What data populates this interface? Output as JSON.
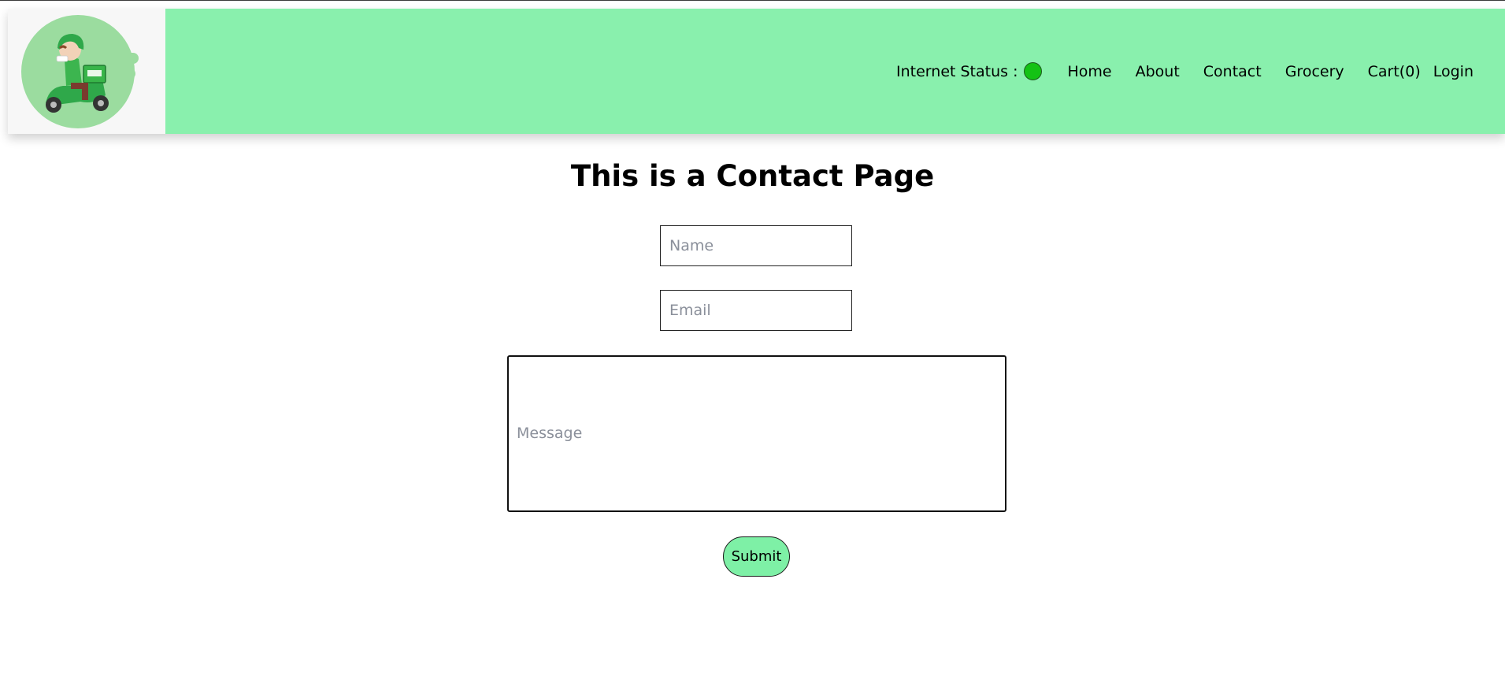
{
  "header": {
    "logo_alt": "delivery-scooter-logo",
    "internet_status_label": "Internet Status :",
    "internet_status_color": "#14c214",
    "nav": {
      "home": "Home",
      "about": "About",
      "contact": "Contact",
      "grocery": "Grocery",
      "cart": "Cart(0)",
      "login": "Login"
    },
    "bar_color": "#89f0ad"
  },
  "main": {
    "title": "This is a Contact Page",
    "form": {
      "name_placeholder": "Name",
      "email_placeholder": "Email",
      "message_placeholder": "Message",
      "submit_label": "Submit",
      "submit_color": "#7ef0a6"
    }
  }
}
